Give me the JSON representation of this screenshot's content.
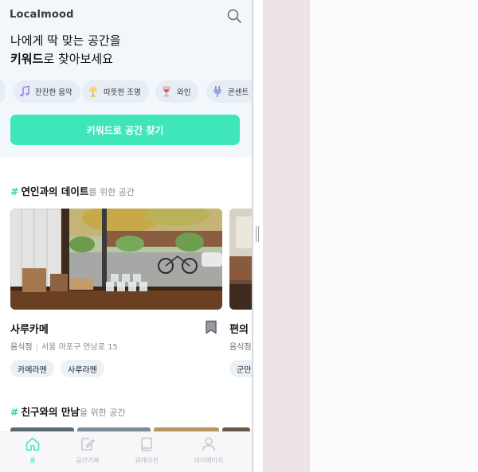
{
  "app": {
    "brand": "Localmood"
  },
  "hero": {
    "headline_line1": "나에게 딱 맞는 공간을",
    "headline_line2_bold": "키워드",
    "headline_line2_rest": "로 찾아보세요",
    "chips": [
      {
        "icon": "music-note-icon",
        "label": "잔잔한 음악"
      },
      {
        "icon": "lamp-icon",
        "label": "따뜻한 조명"
      },
      {
        "icon": "wine-glass-icon",
        "label": "와인"
      },
      {
        "icon": "plug-icon",
        "label": "콘센트 있"
      }
    ],
    "cta_label": "키워드로 공간 찾기"
  },
  "section1": {
    "hash": "#",
    "keyword": "연인과의 데이트",
    "suffix": "를 위한 공간",
    "cards": [
      {
        "name": "사루카메",
        "category": "음식점",
        "address": "서울 마포구 연남로 15",
        "tags": [
          "카메라멘",
          "사루라멘"
        ]
      },
      {
        "name": "편의",
        "category": "음식점",
        "address": "",
        "tags": [
          "군만"
        ]
      }
    ]
  },
  "section2": {
    "hash": "#",
    "keyword": "친구와의 만남",
    "suffix": "을 위한 공간"
  },
  "nav": {
    "items": [
      {
        "icon": "home-icon",
        "label": "홈",
        "active": true
      },
      {
        "icon": "pencil-note-icon",
        "label": "공간기록",
        "active": false
      },
      {
        "icon": "book-icon",
        "label": "큐레이션",
        "active": false
      },
      {
        "icon": "person-icon",
        "label": "마이페이지",
        "active": false
      }
    ]
  },
  "colors": {
    "accent": "#3ee6ba",
    "hero_bg": "#f2f7fc",
    "chip_bg": "#e6edf4",
    "tag_bg": "#eaf1f7"
  }
}
